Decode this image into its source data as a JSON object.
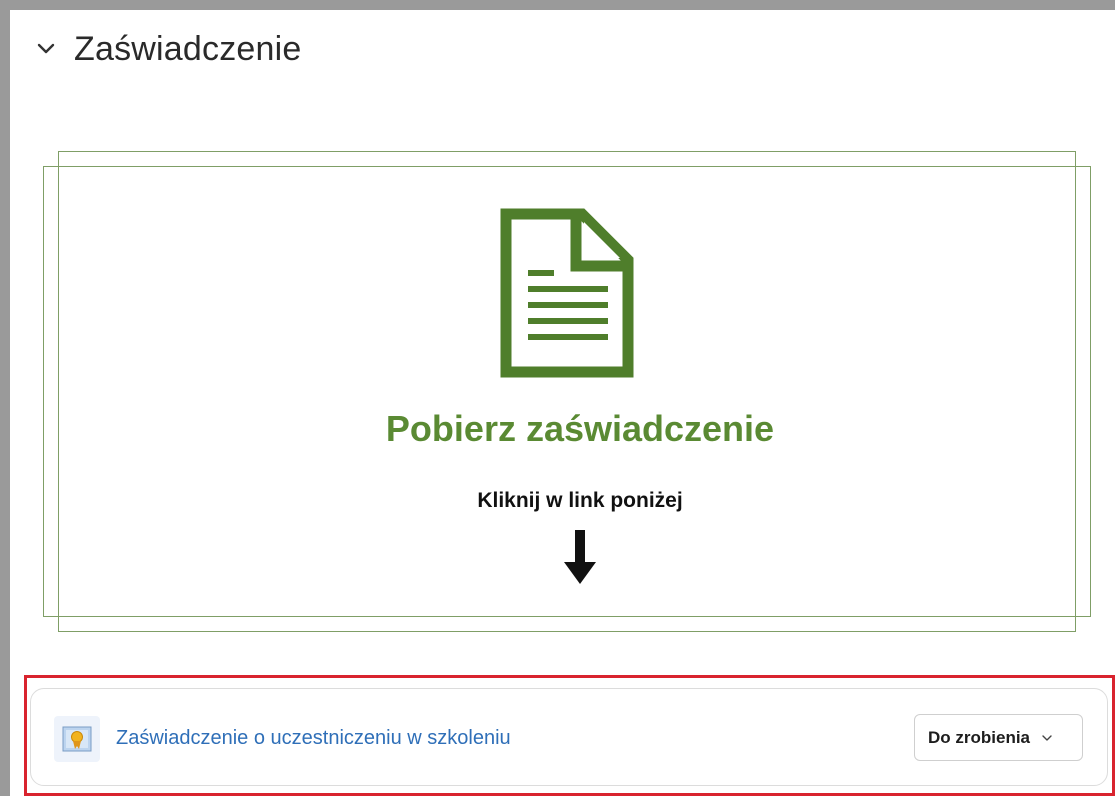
{
  "section": {
    "title": "Zaświadczenie",
    "collapse_icon": "chevron-down-icon"
  },
  "banner": {
    "icon": "document-icon",
    "heading": "Pobierz zaświadczenie",
    "subheading": "Kliknij w link poniżej",
    "arrow_icon": "arrow-down-icon",
    "accent_color": "#4f7e2b"
  },
  "activity": {
    "icon": "certificate-icon",
    "link_text": "Zaświadczenie o uczestniczeniu w szkoleniu",
    "status_label": "Do zrobienia",
    "status_icon": "chevron-down-icon",
    "link_color": "#2f6fb8"
  },
  "highlight": {
    "color": "#d9232e"
  }
}
